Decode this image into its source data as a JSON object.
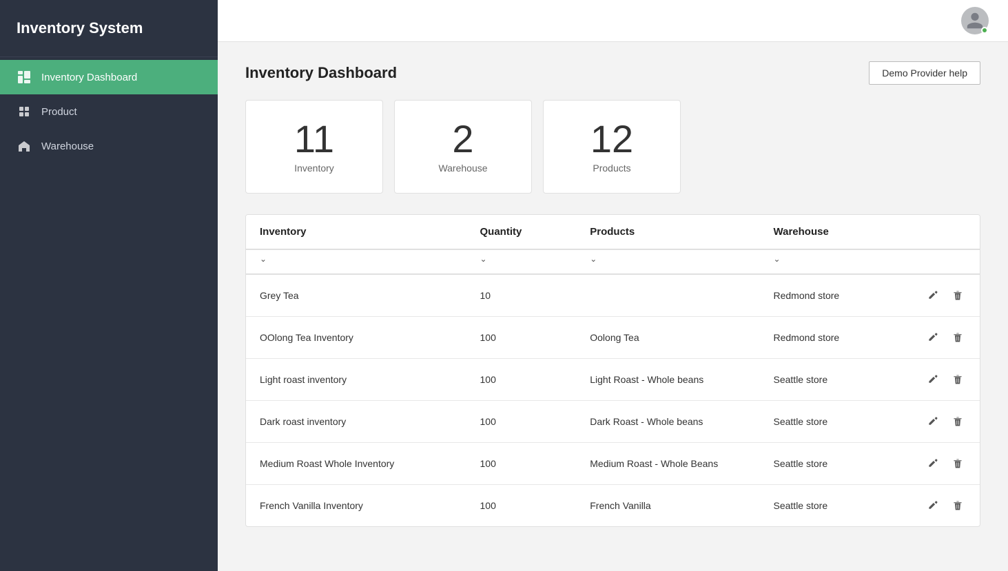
{
  "app": {
    "title": "Inventory System"
  },
  "sidebar": {
    "items": [
      {
        "id": "dashboard",
        "label": "Inventory Dashboard",
        "active": true
      },
      {
        "id": "product",
        "label": "Product",
        "active": false
      },
      {
        "id": "warehouse",
        "label": "Warehouse",
        "active": false
      }
    ]
  },
  "header": {
    "help_button_label": "Demo Provider help"
  },
  "page": {
    "title": "Inventory Dashboard"
  },
  "stats": [
    {
      "value": "11",
      "label": "Inventory"
    },
    {
      "value": "2",
      "label": "Warehouse"
    },
    {
      "value": "12",
      "label": "Products"
    }
  ],
  "table": {
    "columns": [
      {
        "id": "inventory",
        "label": "Inventory"
      },
      {
        "id": "quantity",
        "label": "Quantity"
      },
      {
        "id": "products",
        "label": "Products"
      },
      {
        "id": "warehouse",
        "label": "Warehouse"
      }
    ],
    "rows": [
      {
        "inventory": "Grey Tea",
        "quantity": "10",
        "products": "",
        "warehouse": "Redmond store"
      },
      {
        "inventory": "OOlong Tea Inventory",
        "quantity": "100",
        "products": "Oolong Tea",
        "warehouse": "Redmond store"
      },
      {
        "inventory": "Light roast inventory",
        "quantity": "100",
        "products": "Light Roast - Whole beans",
        "warehouse": "Seattle store"
      },
      {
        "inventory": "Dark roast inventory",
        "quantity": "100",
        "products": "Dark Roast - Whole beans",
        "warehouse": "Seattle store"
      },
      {
        "inventory": "Medium Roast Whole Inventory",
        "quantity": "100",
        "products": "Medium Roast - Whole Beans",
        "warehouse": "Seattle store"
      },
      {
        "inventory": "French Vanilla Inventory",
        "quantity": "100",
        "products": "French Vanilla",
        "warehouse": "Seattle store"
      }
    ]
  }
}
